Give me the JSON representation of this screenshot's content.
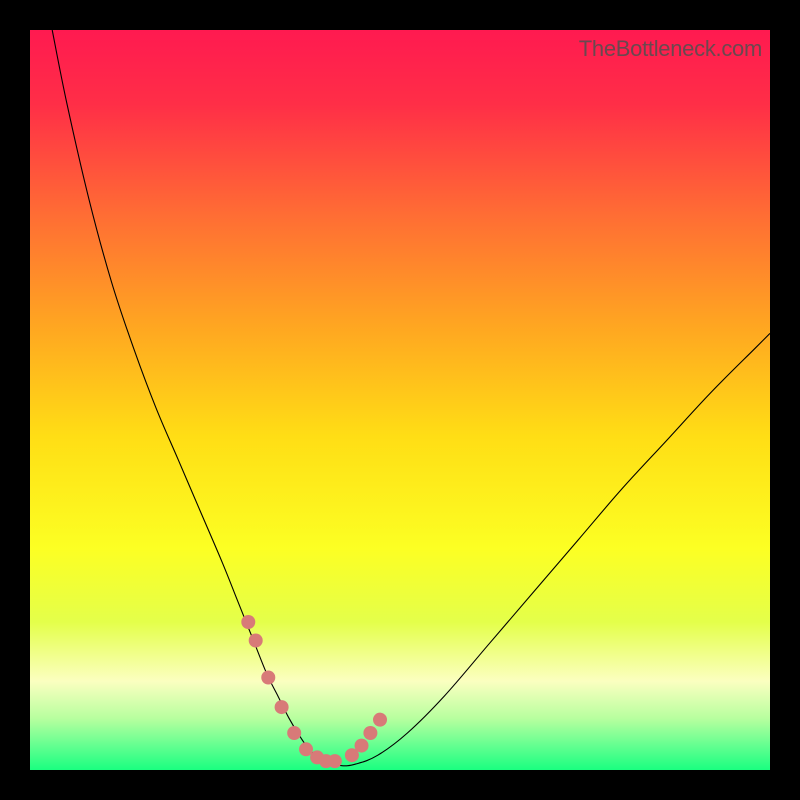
{
  "watermark": "TheBottleneck.com",
  "chart_data": {
    "type": "line",
    "title": "",
    "xlabel": "",
    "ylabel": "",
    "xlim": [
      0,
      100
    ],
    "ylim": [
      0,
      100
    ],
    "grid": false,
    "legend": false,
    "background_gradient": {
      "stops": [
        {
          "offset": 0,
          "color": "#ff1a50"
        },
        {
          "offset": 0.1,
          "color": "#ff2e47"
        },
        {
          "offset": 0.25,
          "color": "#ff6d34"
        },
        {
          "offset": 0.4,
          "color": "#ffa621"
        },
        {
          "offset": 0.55,
          "color": "#ffde15"
        },
        {
          "offset": 0.7,
          "color": "#fcff23"
        },
        {
          "offset": 0.8,
          "color": "#e4ff4a"
        },
        {
          "offset": 0.88,
          "color": "#fbffc0"
        },
        {
          "offset": 0.93,
          "color": "#b8ff9f"
        },
        {
          "offset": 0.97,
          "color": "#5dff8f"
        },
        {
          "offset": 1.0,
          "color": "#1aff80"
        }
      ]
    },
    "series": [
      {
        "name": "curve",
        "color": "#000000",
        "stroke_width": 1.1,
        "x": [
          3,
          5,
          8,
          11,
          14,
          17,
          20,
          23,
          26,
          28,
          30,
          32,
          33.5,
          35,
          36.5,
          38,
          40,
          42,
          44,
          47,
          51,
          56,
          62,
          68,
          74,
          80,
          86,
          92,
          98,
          100
        ],
        "y": [
          100,
          90,
          77,
          66,
          57,
          49,
          42,
          35,
          28,
          23,
          18,
          13,
          10,
          7,
          4.5,
          2.5,
          1.2,
          0.6,
          0.8,
          2,
          5,
          10,
          17,
          24,
          31,
          38,
          44.5,
          51,
          57,
          59
        ]
      },
      {
        "name": "markers",
        "type": "scatter",
        "color": "#d87a78",
        "marker_size": 14,
        "x": [
          29.5,
          30.5,
          32.2,
          34.0,
          35.7,
          37.3,
          38.8,
          40.0,
          41.2,
          43.5,
          44.8,
          46.0,
          47.3
        ],
        "y": [
          20.0,
          17.5,
          12.5,
          8.5,
          5.0,
          2.8,
          1.7,
          1.2,
          1.2,
          2.0,
          3.3,
          5.0,
          6.8
        ]
      }
    ]
  }
}
